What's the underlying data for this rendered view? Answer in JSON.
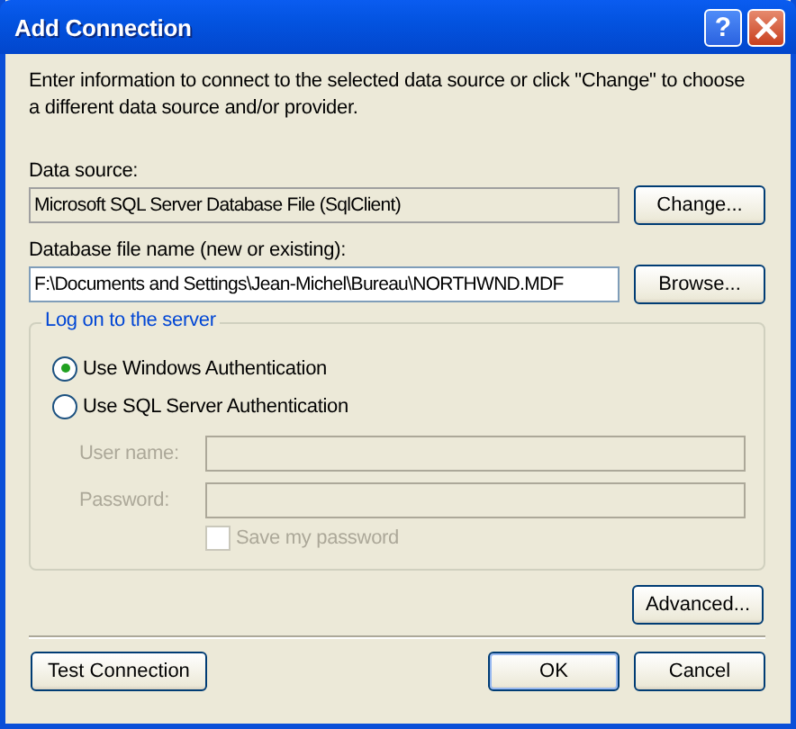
{
  "window": {
    "title": "Add Connection",
    "help_button": "?"
  },
  "intro": "Enter information to connect to the selected data source or click \"Change\" to choose a different data source and/or provider.",
  "data_source": {
    "label": "Data source:",
    "value": "Microsoft SQL Server Database File (SqlClient)",
    "button": "Change..."
  },
  "database_file": {
    "label": "Database file name (new or existing):",
    "value": "F:\\Documents and Settings\\Jean-Michel\\Bureau\\NORTHWND.MDF",
    "button": "Browse..."
  },
  "logon": {
    "title": "Log on to the server",
    "options": [
      {
        "label": "Use Windows Authentication",
        "selected": true
      },
      {
        "label": "Use SQL Server Authentication",
        "selected": false
      }
    ],
    "fields": [
      {
        "label": "User name:",
        "disabled": true
      },
      {
        "label": "Password:",
        "disabled": true
      }
    ],
    "save_password": {
      "label": "Save my password",
      "checked": false,
      "disabled": true
    }
  },
  "advanced_button": "Advanced...",
  "buttons": [
    {
      "label": "Test Connection",
      "default": false
    },
    {
      "label": "OK",
      "default": true
    },
    {
      "label": "Cancel",
      "default": false
    }
  ]
}
